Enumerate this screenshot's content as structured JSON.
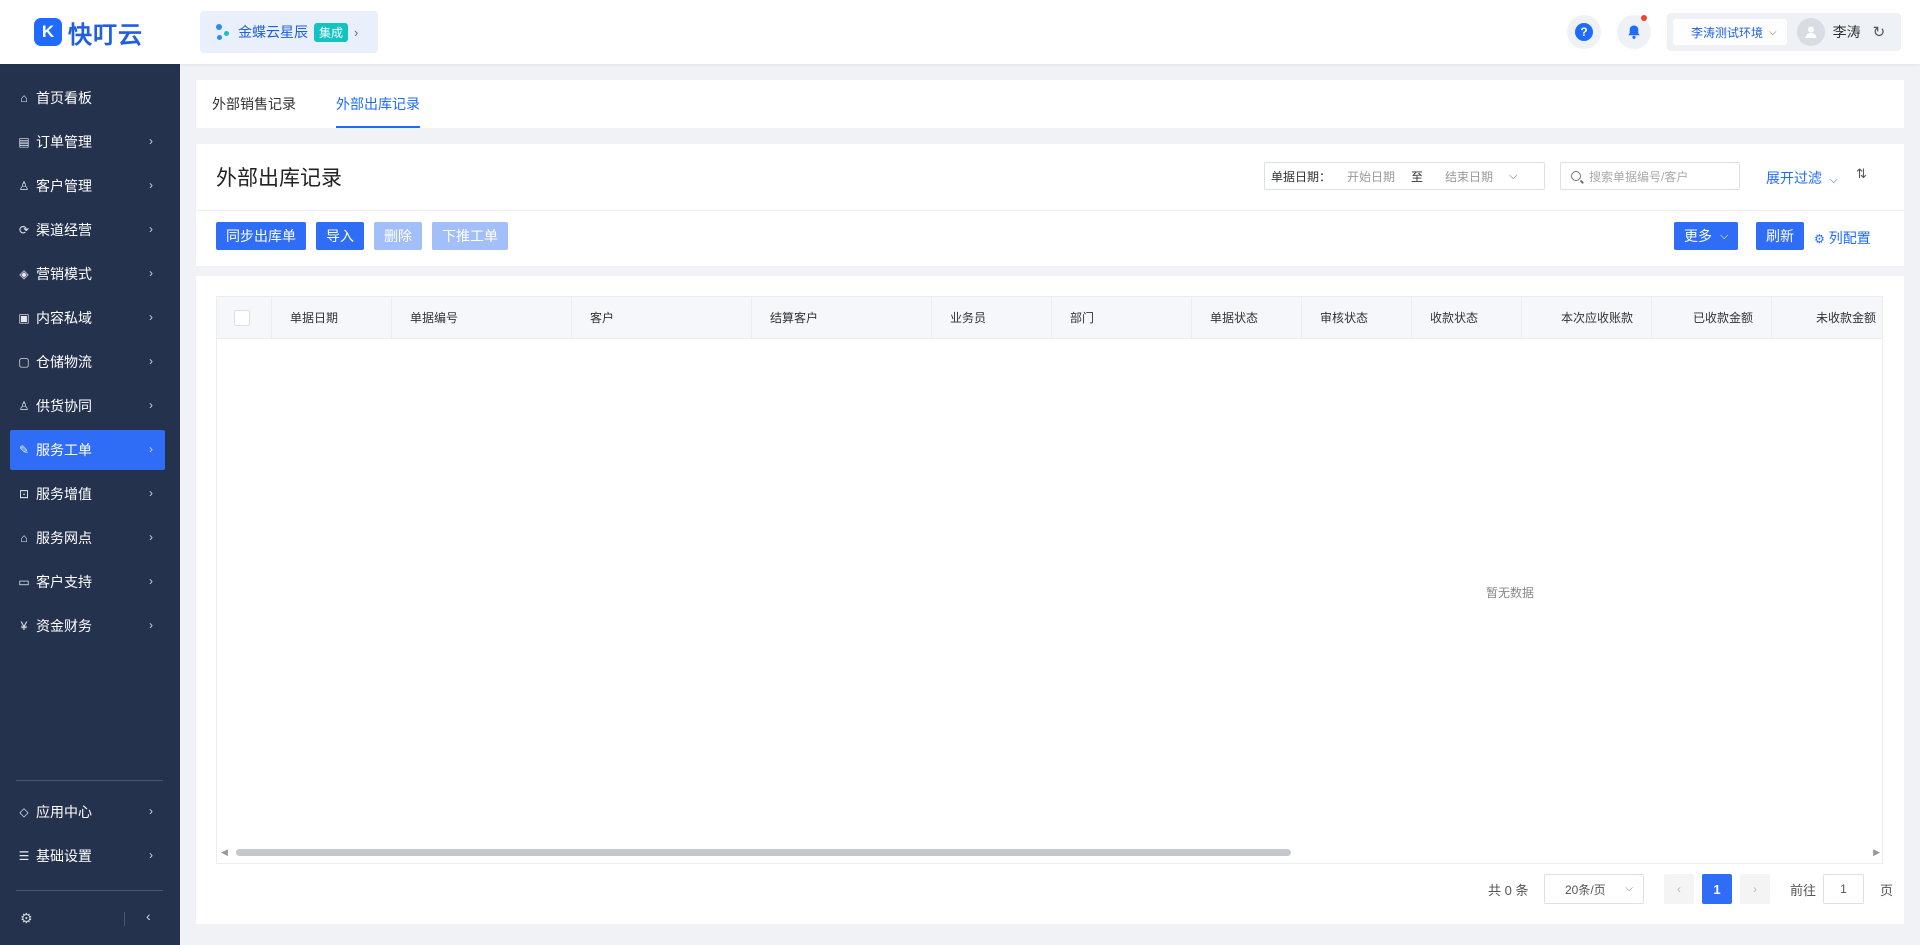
{
  "app": {
    "logo_mark": "K",
    "logo_text": "快叮云"
  },
  "integration": {
    "name": "金蝶云星辰",
    "badge": "集成"
  },
  "header": {
    "help_icon": "?",
    "environment": "李涛测试环境",
    "user_name": "李涛"
  },
  "sidebar": {
    "items": [
      {
        "label": "首页看板",
        "icon": "home-icon",
        "glyph": "⌂"
      },
      {
        "label": "订单管理",
        "icon": "order-icon",
        "glyph": "▤"
      },
      {
        "label": "客户管理",
        "icon": "user-icon",
        "glyph": "♙"
      },
      {
        "label": "渠道经营",
        "icon": "channel-icon",
        "glyph": "⟳"
      },
      {
        "label": "营销模式",
        "icon": "tag-icon",
        "glyph": "◈"
      },
      {
        "label": "内容私域",
        "icon": "image-icon",
        "glyph": "▣"
      },
      {
        "label": "仓储物流",
        "icon": "box-icon",
        "glyph": "▢"
      },
      {
        "label": "供货协同",
        "icon": "supply-icon",
        "glyph": "♙"
      },
      {
        "label": "服务工单",
        "icon": "ticket-icon",
        "glyph": "✎"
      },
      {
        "label": "服务增值",
        "icon": "bag-icon",
        "glyph": "⊡"
      },
      {
        "label": "服务网点",
        "icon": "store-icon",
        "glyph": "⌂"
      },
      {
        "label": "客户支持",
        "icon": "support-icon",
        "glyph": "▭"
      },
      {
        "label": "资金财务",
        "icon": "yuan-icon",
        "glyph": "¥"
      }
    ],
    "bottom_items": [
      {
        "label": "应用中心",
        "icon": "cube-icon",
        "glyph": "◇"
      },
      {
        "label": "基础设置",
        "icon": "settings-icon",
        "glyph": "☰"
      }
    ]
  },
  "tabs": [
    {
      "label": "外部销售记录"
    },
    {
      "label": "外部出库记录"
    }
  ],
  "page": {
    "title": "外部出库记录",
    "filter": {
      "date_label": "单据日期：",
      "start_placeholder": "开始日期",
      "separator": "至",
      "end_placeholder": "结束日期",
      "search_placeholder": "搜索单据编号/客户",
      "expand_filter": "展开过滤"
    },
    "actions": {
      "sync": "同步出库单",
      "import": "导入",
      "delete": "删除",
      "push": "下推工单",
      "more": "更多",
      "refresh": "刷新",
      "column_config": "列配置"
    }
  },
  "table": {
    "columns": [
      "单据日期",
      "单据编号",
      "客户",
      "结算客户",
      "业务员",
      "部门",
      "单据状态",
      "审核状态",
      "收款状态",
      "本次应收账款",
      "已收款金额",
      "未收款金额"
    ],
    "empty_text": "暂无数据"
  },
  "pagination": {
    "total": "共 0 条",
    "page_size": "20条/页",
    "current_page": "1",
    "goto_label": "前往",
    "goto_value": "1",
    "page_suffix": "页"
  },
  "colors": {
    "primary": "#2f6df6",
    "sidebar_bg": "#24324e",
    "active_item": "#2f6df6"
  }
}
